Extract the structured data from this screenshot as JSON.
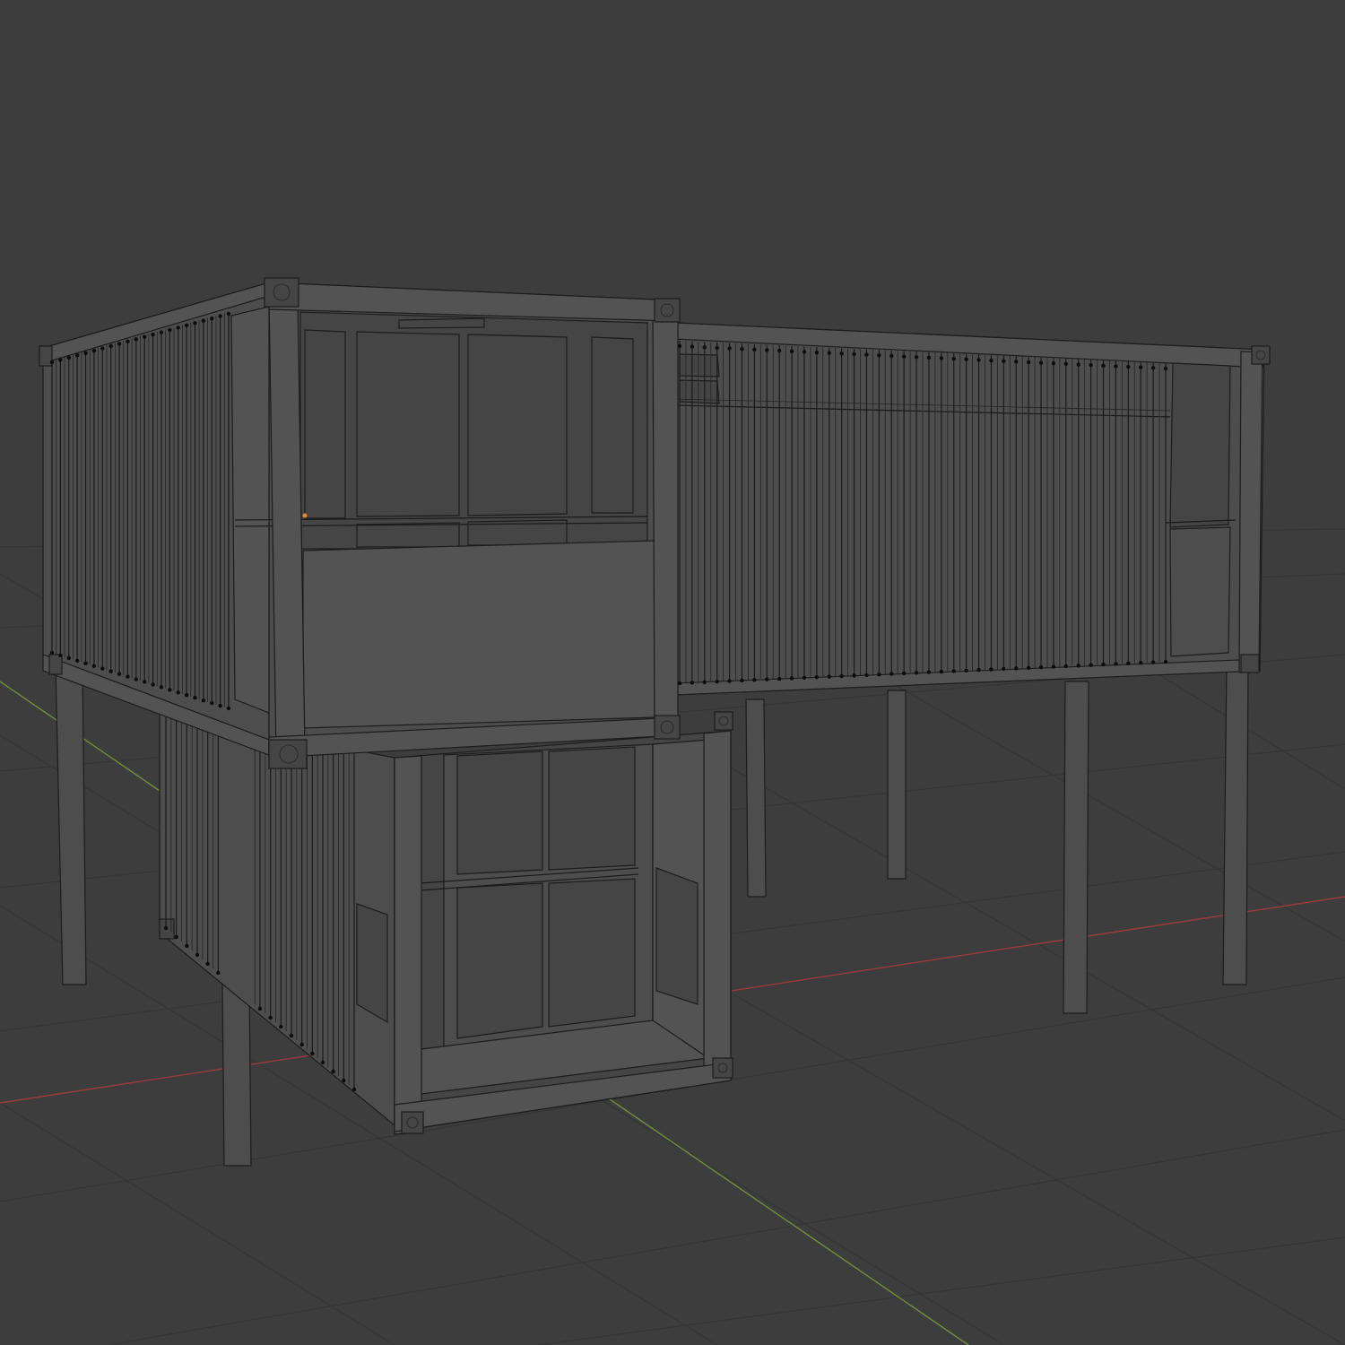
{
  "viewport": {
    "background": "#3d3d3d",
    "grid_color": "#353535",
    "x_axis_color": "#9b3b3b",
    "y_axis_color": "#6e8f3a",
    "mesh_color": "#4d4d4d",
    "wire_color": "#1a1a1a",
    "selected_vertex_color": "#f08a24"
  }
}
